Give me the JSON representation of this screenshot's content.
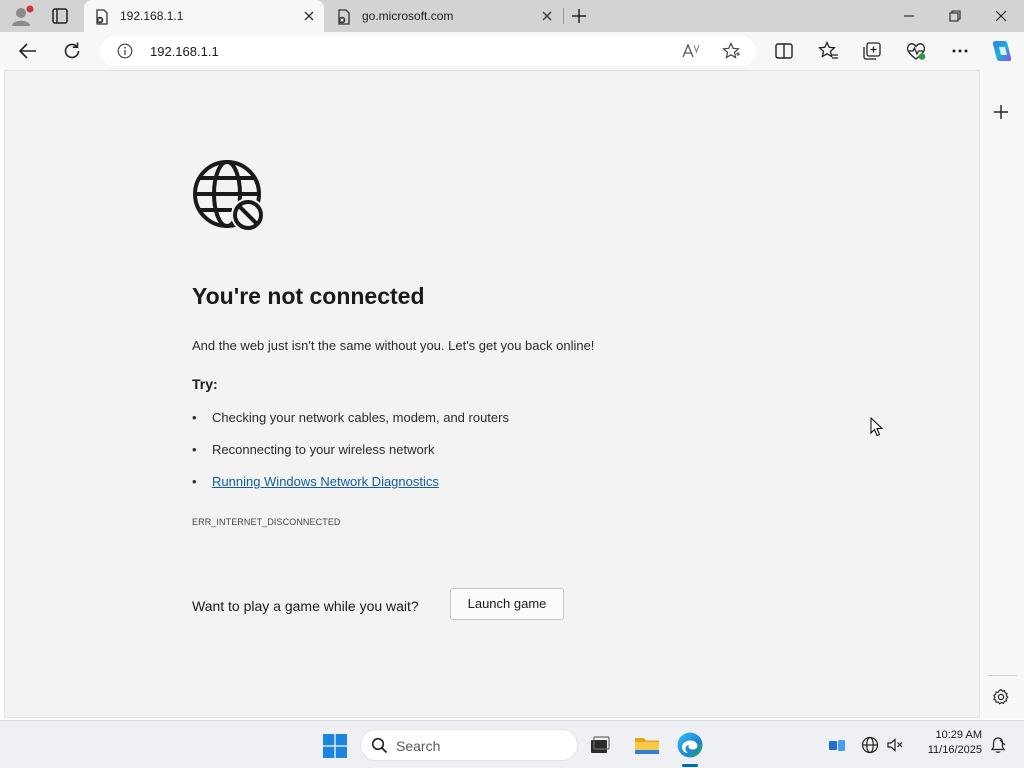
{
  "tabs": [
    {
      "title": "192.168.1.1",
      "active": true
    },
    {
      "title": "go.microsoft.com",
      "active": false
    }
  ],
  "address_bar": {
    "url": "192.168.1.1"
  },
  "error_page": {
    "title": "You're not connected",
    "subtitle": "And the web just isn't the same without you. Let's get you back online!",
    "try_label": "Try:",
    "suggestions": [
      {
        "text": "Checking your network cables, modem, and routers",
        "is_link": false
      },
      {
        "text": "Reconnecting to your wireless network",
        "is_link": false
      },
      {
        "text": "Running Windows Network Diagnostics",
        "is_link": true
      }
    ],
    "error_code": "ERR_INTERNET_DISCONNECTED",
    "game_prompt": "Want to play a game while you wait?",
    "launch_button": "Launch game"
  },
  "taskbar": {
    "search_label": "Search",
    "time": "10:29 AM",
    "date": "11/16/2025"
  },
  "colors": {
    "link": "#115ea3",
    "accent": "#0067c0",
    "page_bg": "#f3f3f3"
  }
}
